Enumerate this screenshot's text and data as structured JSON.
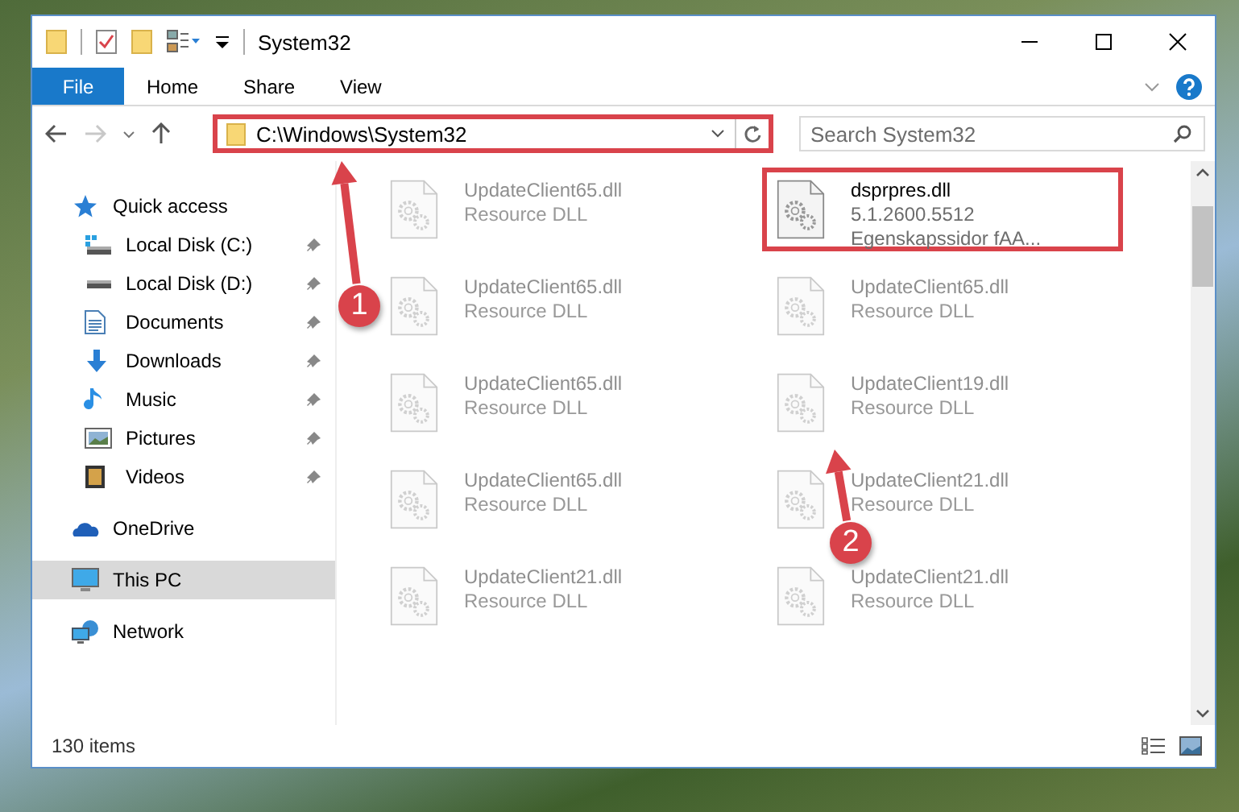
{
  "window": {
    "title": "System32"
  },
  "ribbon_tabs": [
    {
      "label": "File",
      "kind": "file",
      "selected": false
    },
    {
      "label": "Home",
      "kind": "tab",
      "selected": false
    },
    {
      "label": "Share",
      "kind": "tab",
      "selected": false
    },
    {
      "label": "View",
      "kind": "tab",
      "selected": false
    }
  ],
  "address_bar": {
    "path": "C:\\Windows\\System32",
    "highlighted": true
  },
  "search": {
    "placeholder": "Search System32"
  },
  "sidebar": {
    "items": [
      {
        "label": "Quick access",
        "selected": false,
        "children": [
          {
            "label": "Local Disk (C:)",
            "pinned": true,
            "selected": false
          },
          {
            "label": "Local Disk (D:)",
            "pinned": true,
            "selected": false
          },
          {
            "label": "Documents",
            "pinned": true,
            "selected": false
          },
          {
            "label": "Downloads",
            "pinned": true,
            "selected": false
          },
          {
            "label": "Music",
            "pinned": true,
            "selected": false
          },
          {
            "label": "Pictures",
            "pinned": true,
            "selected": false
          },
          {
            "label": "Videos",
            "pinned": true,
            "selected": false
          }
        ]
      },
      {
        "label": "OneDrive",
        "selected": false
      },
      {
        "label": "This PC",
        "selected": true
      },
      {
        "label": "Network",
        "selected": false
      }
    ]
  },
  "files": [
    {
      "name": "UpdateClient65.dll",
      "details": [
        "Resource DLL"
      ],
      "dimmed": true,
      "highlighted": false
    },
    {
      "name": "UpdateClient65.dll",
      "details": [
        "Resource DLL"
      ],
      "dimmed": true,
      "highlighted": false
    },
    {
      "name": "UpdateClient65.dll",
      "details": [
        "Resource DLL"
      ],
      "dimmed": true,
      "highlighted": false
    },
    {
      "name": "UpdateClient65.dll",
      "details": [
        "Resource DLL"
      ],
      "dimmed": true,
      "highlighted": false
    },
    {
      "name": "UpdateClient21.dll",
      "details": [
        "Resource DLL"
      ],
      "dimmed": true,
      "highlighted": false
    },
    {
      "name": "dsprpres.dll",
      "details": [
        "5.1.2600.5512",
        "Egenskapssidor fAA..."
      ],
      "dimmed": false,
      "highlighted": true
    },
    {
      "name": "UpdateClient65.dll",
      "details": [
        "Resource DLL"
      ],
      "dimmed": true,
      "highlighted": false
    },
    {
      "name": "UpdateClient19.dll",
      "details": [
        "Resource DLL"
      ],
      "dimmed": true,
      "highlighted": false
    },
    {
      "name": "UpdateClient21.dll",
      "details": [
        "Resource DLL"
      ],
      "dimmed": true,
      "highlighted": false
    },
    {
      "name": "UpdateClient21.dll",
      "details": [
        "Resource DLL"
      ],
      "dimmed": true,
      "highlighted": false
    }
  ],
  "status_bar": {
    "item_count": "130 items"
  },
  "annotations": [
    {
      "number": "1"
    },
    {
      "number": "2"
    }
  ]
}
